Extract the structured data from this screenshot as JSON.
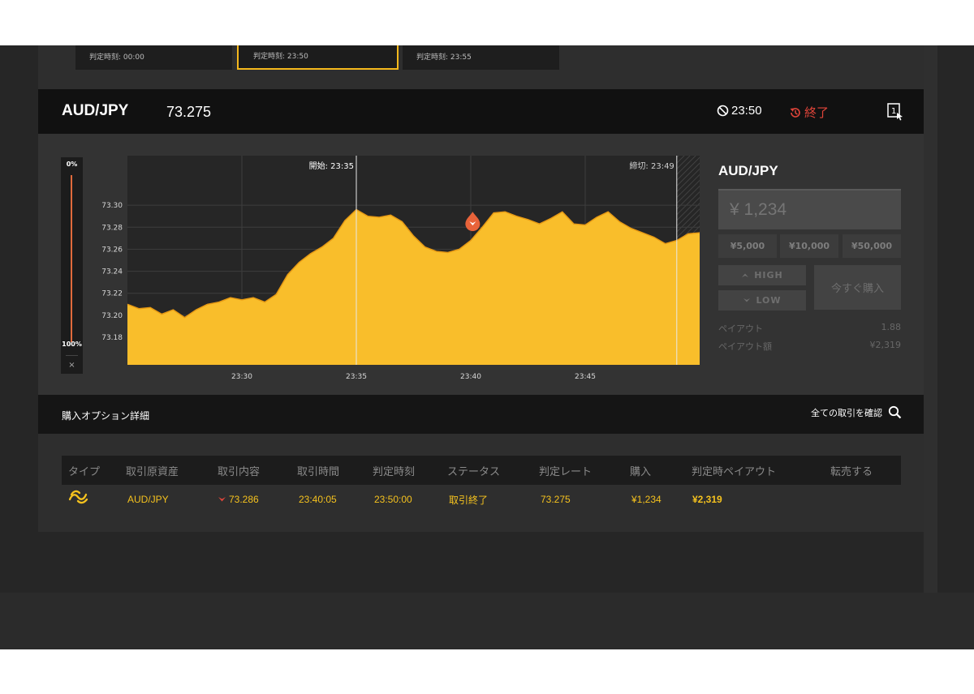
{
  "slots": [
    {
      "label": "判定時刻: 00:00"
    },
    {
      "label": "判定時刻: 23:50"
    },
    {
      "label": "判定時刻: 23:55"
    }
  ],
  "header": {
    "asset": "AUD/JPY",
    "rate": "73.275",
    "expiry": "23:50",
    "status": "終了"
  },
  "progress": {
    "top_label": "0%",
    "bottom_label": "100%",
    "close_label": "×",
    "fraction": 1.0
  },
  "chart_data": {
    "type": "area",
    "x_range": [
      "23:25",
      "23:50"
    ],
    "ylim": [
      73.155,
      73.345
    ],
    "yticks": [
      "73.30",
      "73.28",
      "73.26",
      "73.24",
      "73.22",
      "73.20",
      "73.18"
    ],
    "xticks": [
      "23:30",
      "23:35",
      "23:40",
      "23:45"
    ],
    "start_label": "開始: 23:35",
    "cutoff_label": "締切: 23:49",
    "entry_rate": 73.286,
    "color": "#f9be2b",
    "points": [
      [
        "23:25:00",
        73.21
      ],
      [
        "23:25:30",
        73.206
      ],
      [
        "23:26:00",
        73.207
      ],
      [
        "23:26:30",
        73.201
      ],
      [
        "23:27:00",
        73.205
      ],
      [
        "23:27:30",
        73.198
      ],
      [
        "23:28:00",
        73.205
      ],
      [
        "23:28:30",
        73.21
      ],
      [
        "23:29:00",
        73.212
      ],
      [
        "23:29:30",
        73.216
      ],
      [
        "23:30:00",
        73.214
      ],
      [
        "23:30:30",
        73.216
      ],
      [
        "23:31:00",
        73.212
      ],
      [
        "23:31:30",
        73.219
      ],
      [
        "23:32:00",
        73.237
      ],
      [
        "23:32:30",
        73.248
      ],
      [
        "23:33:00",
        73.256
      ],
      [
        "23:33:30",
        73.262
      ],
      [
        "23:34:00",
        73.27
      ],
      [
        "23:34:30",
        73.286
      ],
      [
        "23:35:00",
        73.296
      ],
      [
        "23:35:30",
        73.29
      ],
      [
        "23:36:00",
        73.289
      ],
      [
        "23:36:30",
        73.291
      ],
      [
        "23:37:00",
        73.285
      ],
      [
        "23:37:30",
        73.272
      ],
      [
        "23:38:00",
        73.262
      ],
      [
        "23:38:30",
        73.258
      ],
      [
        "23:39:00",
        73.257
      ],
      [
        "23:39:30",
        73.26
      ],
      [
        "23:40:00",
        73.268
      ],
      [
        "23:40:30",
        73.28
      ],
      [
        "23:41:00",
        73.293
      ],
      [
        "23:41:30",
        73.294
      ],
      [
        "23:42:00",
        73.29
      ],
      [
        "23:42:30",
        73.287
      ],
      [
        "23:43:00",
        73.283
      ],
      [
        "23:43:30",
        73.288
      ],
      [
        "23:44:00",
        73.294
      ],
      [
        "23:44:30",
        73.283
      ],
      [
        "23:45:00",
        73.282
      ],
      [
        "23:45:30",
        73.289
      ],
      [
        "23:46:00",
        73.294
      ],
      [
        "23:46:30",
        73.285
      ],
      [
        "23:47:00",
        73.279
      ],
      [
        "23:47:30",
        73.275
      ],
      [
        "23:48:00",
        73.271
      ],
      [
        "23:48:30",
        73.265
      ],
      [
        "23:49:00",
        73.268
      ],
      [
        "23:49:30",
        73.274
      ],
      [
        "23:50:00",
        73.275
      ]
    ]
  },
  "order": {
    "asset": "AUD/JPY",
    "amount_placeholder": "¥ 1,234",
    "presets": [
      "¥5,000",
      "¥10,000",
      "¥50,000"
    ],
    "high_label": "HIGH",
    "low_label": "LOW",
    "buy_now_label": "今すぐ購入",
    "payout_label": "ペイアウト",
    "payout_value": "1.88",
    "payout_amount_label": "ペイアウト額",
    "payout_amount_value": "¥2,319"
  },
  "details": {
    "title": "購入オプション詳細",
    "all_trades_label": "全ての取引を確認",
    "columns": [
      "タイプ",
      "取引原資産",
      "取引内容",
      "取引時間",
      "判定時刻",
      "ステータス",
      "判定レート",
      "購入",
      "判定時ペイアウト",
      "転売する"
    ],
    "row": {
      "asset": "AUD/JPY",
      "trade": "73.286",
      "trade_time": "23:40:05",
      "judge_time": "23:50:00",
      "status": "取引終了",
      "judge_rate": "73.275",
      "purchase": "¥1,234",
      "payout": "¥2,319"
    }
  },
  "colors": {
    "accent": "#f5b81c",
    "danger": "#e2453a",
    "area": "#f9be2b"
  }
}
